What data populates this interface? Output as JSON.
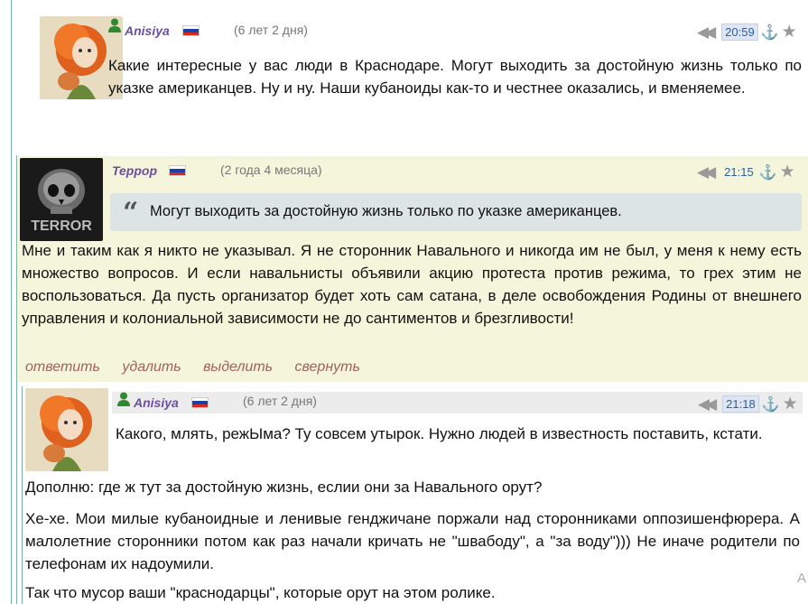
{
  "comments": [
    {
      "author": "Anisiya",
      "age": "(6 лет 2 дня)",
      "time": "20:59",
      "text": "Какие интересные у вас люди в Краснодаре. Могут выходить за достойную жизнь только по указке американцев. Ну и ну. Наши кубаноиды как-то и честнее оказались, и вменяемее."
    },
    {
      "author": "Террор",
      "age": "(2 года 4 месяца)",
      "time": "21:15",
      "quote": "Могут выходить за достойную жизнь только по указке американцев.",
      "text": "Мне и таким как я никто не указывал. Я не сторонник Навального и никогда им не был, у меня к нему есть множество вопросов. И если навальнисты объявили акцию протеста против режима, то грех этим не воспользоваться. Да пусть организатор будет хоть сам сатана, в деле освобождения Родины от внешнего управления и колониальной зависимости не до сантиментов и брезгливости!",
      "actions": [
        "ответить",
        "удалить",
        "выделить",
        "свернуть"
      ]
    },
    {
      "author": "Anisiya",
      "age": "(6 лет 2 дня)",
      "time": "21:18",
      "text": "Какого, млять, режЫма? Ту совсем утырок. Нужно людей в известность поставить, кстати.",
      "extra": [
        "Дополню: где ж тут за достойную жизнь, еслии они за Навального орут?",
        "Хе-хе. Мои милые кубаноидные и ленивые генджичане поржали над сторонниками оппозишенфюрера.  А малолетние сторонники потом как раз начали кричать не \"швабоду\", а \"за воду\"))) Не иначе родители по телефонам их надоумили.",
        "Так что мусор ваши \"краснодарцы\", которые орут на этом ролике."
      ]
    }
  ],
  "edge_glyph": "А",
  "colors": {
    "highlight_bg": "#f5f5dc",
    "name": "#6a4fa0",
    "action": "#a0625a",
    "time": "#2a5fa0"
  }
}
